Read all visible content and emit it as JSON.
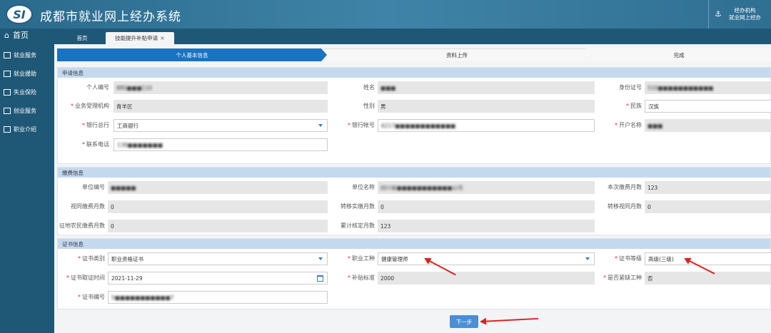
{
  "header": {
    "logo_text": "SI",
    "title": "成都市就业网上经办系统",
    "user_line1": "经办机构",
    "user_line2": "就业网上经办"
  },
  "sidebar": {
    "home": "首页",
    "items": [
      {
        "label": "就业服务"
      },
      {
        "label": "就业援助"
      },
      {
        "label": "失业保险"
      },
      {
        "label": "创业服务"
      },
      {
        "label": "职业介绍"
      }
    ]
  },
  "tabs": {
    "home": "首页",
    "active": "技能提升补贴申请",
    "close": "×"
  },
  "steps": [
    "个人基本信息",
    "资料上传",
    "完成"
  ],
  "apply": {
    "title": "申请信息",
    "personal_no_label": "个人编号",
    "personal_no": "880■■■110",
    "name_label": "姓名",
    "name": "■■■",
    "id_label": "身份证号",
    "id": "510■■■■■■■■■■■",
    "agency_label": "业务受理机构",
    "agency": "青羊区",
    "gender_label": "性别",
    "gender": "男",
    "ethnic_label": "民族",
    "ethnic": "汉族",
    "bank_label": "银行总行",
    "bank": "工商银行",
    "account_label": "银行帐号",
    "account": "6217■■■■■■■■■■■■",
    "holder_label": "开户名称",
    "holder": "■■■",
    "phone_label": "联系电话",
    "phone": "138■■■■■■■"
  },
  "payment": {
    "title": "缴费信息",
    "unit_no_label": "单位编号",
    "unit_no": "■■■■■",
    "unit_name_label": "单位名称",
    "unit_name": "四川省■■■■■■■■■■■公司",
    "months_label": "本次缴费月数",
    "months": "123",
    "deemed_label": "视同缴费月数",
    "deemed": "0",
    "transfer_label": "转移实缴月数",
    "transfer": "0",
    "transfer_deemed_label": "转移视同月数",
    "transfer_deemed": "0",
    "land_label": "征地农民缴费月数",
    "land": "0",
    "total_label": "累计核定月数",
    "total": "123"
  },
  "cert": {
    "title": "证书信息",
    "type_label": "证书类别",
    "type": "职业资格证书",
    "job_label": "职业工种",
    "job": "健康管理师",
    "level_label": "证书等级",
    "level": "高级(三级)",
    "date_label": "证书取证时间",
    "date": "2021-11-29",
    "subsidy_label": "补贴标准",
    "subsidy": "2000",
    "shortage_label": "是否紧缺工种",
    "shortage": "否",
    "no_label": "证书编号",
    "no": "5■■■■■■■■■■■7"
  },
  "buttons": {
    "next": "下一步"
  },
  "colors": {
    "header": "#2f6f92",
    "sidebar": "#1f5877",
    "step_active": "#1a73c2",
    "panel_title": "#c5d9ee",
    "annotation": "#e02020"
  }
}
